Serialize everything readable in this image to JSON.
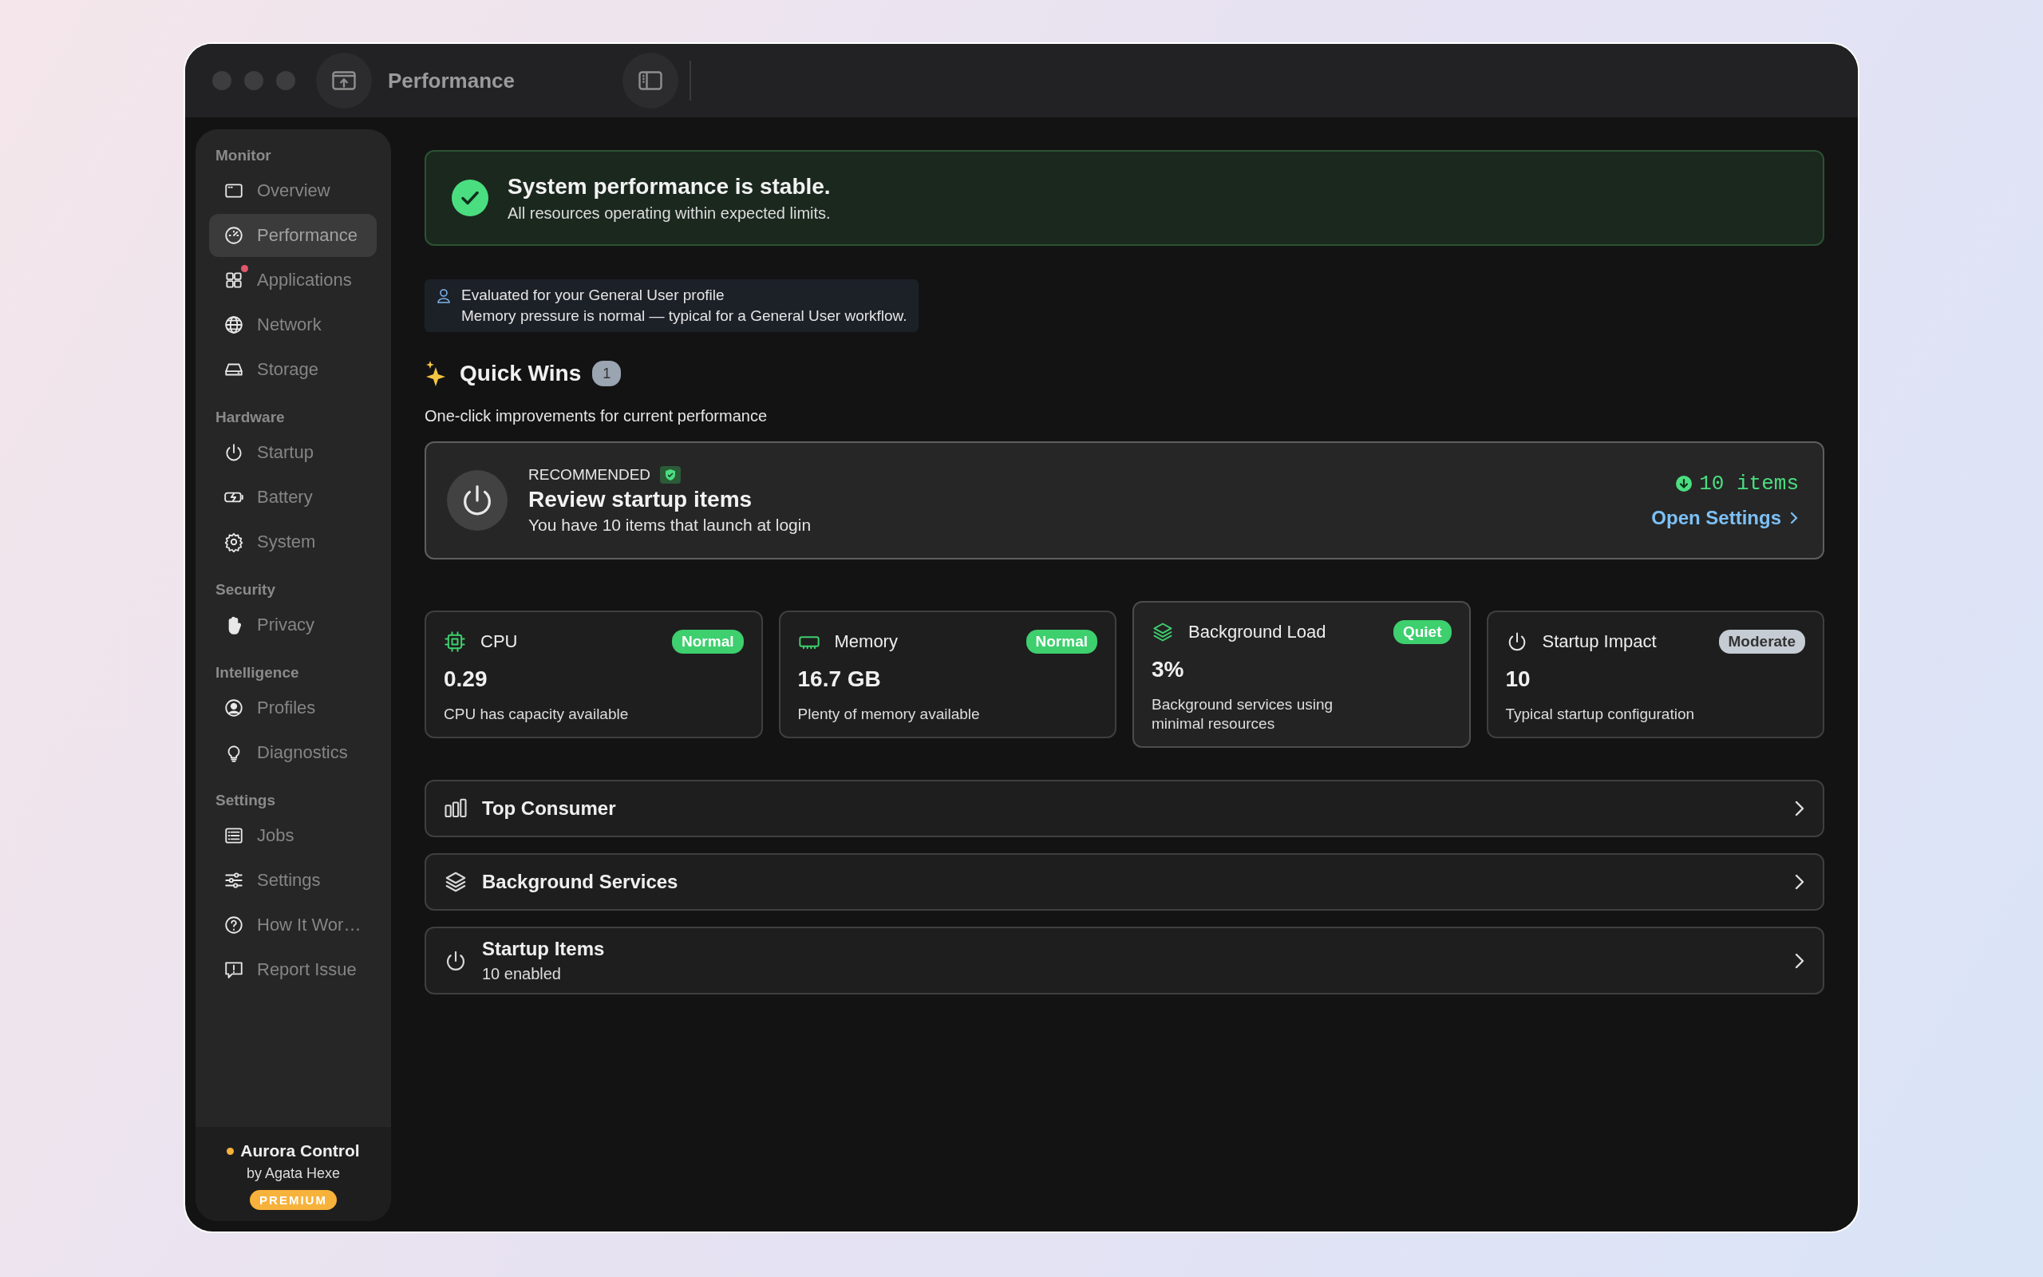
{
  "window": {
    "title": "Performance"
  },
  "sidebar": {
    "sections": [
      {
        "heading": "Monitor",
        "items": [
          {
            "label": "Overview",
            "kind": "overview",
            "selected": false,
            "notification": false
          },
          {
            "label": "Performance",
            "kind": "performance",
            "selected": true,
            "notification": false
          },
          {
            "label": "Applications",
            "kind": "applications",
            "selected": false,
            "notification": true
          },
          {
            "label": "Network",
            "kind": "network",
            "selected": false,
            "notification": false
          },
          {
            "label": "Storage",
            "kind": "storage",
            "selected": false,
            "notification": false
          }
        ]
      },
      {
        "heading": "Hardware",
        "items": [
          {
            "label": "Startup",
            "kind": "power",
            "selected": false,
            "notification": false
          },
          {
            "label": "Battery",
            "kind": "battery",
            "selected": false,
            "notification": false
          },
          {
            "label": "System",
            "kind": "gear",
            "selected": false,
            "notification": false
          }
        ]
      },
      {
        "heading": "Security",
        "items": [
          {
            "label": "Privacy",
            "kind": "hand",
            "selected": false,
            "notification": false
          }
        ]
      },
      {
        "heading": "Intelligence",
        "items": [
          {
            "label": "Profiles",
            "kind": "profile",
            "selected": false,
            "notification": false
          },
          {
            "label": "Diagnostics",
            "kind": "bulb",
            "selected": false,
            "notification": false
          }
        ]
      },
      {
        "heading": "Settings",
        "items": [
          {
            "label": "Jobs",
            "kind": "list",
            "selected": false,
            "notification": false
          },
          {
            "label": "Settings",
            "kind": "sliders",
            "selected": false,
            "notification": false
          },
          {
            "label": "How It Wor…",
            "kind": "question",
            "selected": false,
            "notification": false
          },
          {
            "label": "Report Issue",
            "kind": "report",
            "selected": false,
            "notification": false
          }
        ]
      }
    ],
    "footer": {
      "name": "Aurora Control",
      "byline": "by Agata Hexe",
      "tier": "PREMIUM"
    }
  },
  "status_banner": {
    "title": "System performance is stable.",
    "message": "All resources operating within expected limits."
  },
  "profile_note": {
    "title": "Evaluated for your General User profile",
    "detail": "Memory pressure is normal — typical for a General User workflow."
  },
  "quick_wins": {
    "title": "Quick Wins",
    "count": "1",
    "subtitle": "One-click improvements for current performance",
    "card": {
      "tag": "RECOMMENDED",
      "title": "Review startup items",
      "detail": "You have 10 items that launch at login",
      "count": "10 items",
      "action": "Open Settings"
    }
  },
  "metrics": [
    {
      "kind": "cpu",
      "label": "CPU",
      "status": "Normal",
      "color": "#3ecf6e",
      "value": "0.29",
      "note": "CPU has capacity available",
      "selected": false
    },
    {
      "kind": "memory",
      "label": "Memory",
      "status": "Normal",
      "color": "#3ecf6e",
      "value": "16.7 GB",
      "note": "Plenty of memory available",
      "selected": false
    },
    {
      "kind": "layers",
      "label": "Background Load",
      "status": "Quiet",
      "color": "#3ecf6e",
      "value": "3%",
      "note": "Background services using minimal resources",
      "selected": true
    },
    {
      "kind": "power",
      "label": "Startup Impact",
      "status": "Moderate",
      "color": "#c5ccd3",
      "value": "10",
      "note": "Typical startup configuration",
      "selected": false
    }
  ],
  "sections": [
    {
      "kind": "bars",
      "title": "Top Consumer"
    },
    {
      "kind": "layers",
      "title": "Background Services"
    },
    {
      "kind": "power",
      "title": "Startup Items",
      "detail": "10 enabled"
    }
  ]
}
